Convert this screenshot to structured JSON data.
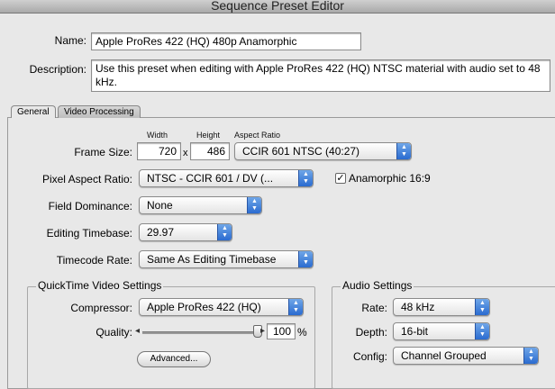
{
  "window": {
    "title": "Sequence Preset Editor"
  },
  "name": {
    "label": "Name:",
    "value": "Apple ProRes 422 (HQ) 480p Anamorphic"
  },
  "description": {
    "label": "Description:",
    "value": "Use this preset when editing with Apple ProRes 422 (HQ) NTSC material with audio set to 48 kHz."
  },
  "tabs": [
    {
      "label": "General"
    },
    {
      "label": "Video Processing"
    }
  ],
  "frame_size": {
    "label": "Frame Size:",
    "width_label": "Width",
    "height_label": "Height",
    "aspect_label": "Aspect Ratio",
    "width": "720",
    "x": "x",
    "height": "486",
    "aspect": "CCIR 601 NTSC (40:27)"
  },
  "pixel_aspect": {
    "label": "Pixel Aspect Ratio:",
    "value": "NTSC - CCIR 601 / DV (...",
    "anamorphic_label": "Anamorphic 16:9",
    "anamorphic_checked": "✓"
  },
  "field_dominance": {
    "label": "Field Dominance:",
    "value": "None"
  },
  "editing_timebase": {
    "label": "Editing Timebase:",
    "value": "29.97"
  },
  "timecode_rate": {
    "label": "Timecode Rate:",
    "value": "Same As Editing Timebase"
  },
  "quicktime": {
    "title": "QuickTime Video Settings",
    "compressor_label": "Compressor:",
    "compressor": "Apple ProRes 422 (HQ)",
    "quality_label": "Quality:",
    "quality": "100",
    "quality_unit": "%",
    "advanced_label": "Advanced...",
    "quality_fraction": 1.0
  },
  "audio": {
    "title": "Audio Settings",
    "rate_label": "Rate:",
    "rate": "48 kHz",
    "depth_label": "Depth:",
    "depth": "16-bit",
    "config_label": "Config:",
    "config": "Channel Grouped"
  },
  "icons": {
    "popup_arrows": "▲\n▼",
    "slider_min": "◂",
    "slider_max": "▸"
  },
  "colors": {
    "accent": "#2a6bd0"
  }
}
